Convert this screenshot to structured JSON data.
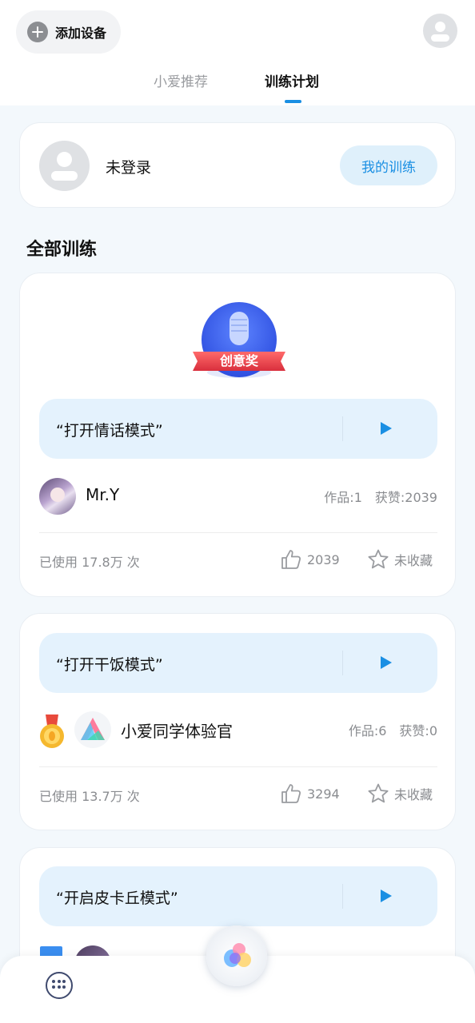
{
  "header": {
    "add_device_label": "添加设备",
    "tabs": [
      {
        "label": "小爱推荐",
        "active": false
      },
      {
        "label": "训练计划",
        "active": true
      }
    ]
  },
  "login": {
    "status_text": "未登录",
    "my_training_label": "我的训练"
  },
  "section_title": "全部训练",
  "badge_text": "创意奖",
  "trainings": [
    {
      "phrase": "“打开情话模式”",
      "author": "Mr.Y",
      "works": "作品:1",
      "likes_received": "获赞:2039",
      "used": "已使用 17.8万 次",
      "like_count": "2039",
      "fav_label": "未收藏"
    },
    {
      "phrase": "“打开干饭模式”",
      "author": "小爱同学体验官",
      "works": "作品:6",
      "likes_received": "获赞:0",
      "used": "已使用 13.7万 次",
      "like_count": "3294",
      "fav_label": "未收藏"
    },
    {
      "phrase": "“开启皮卡丘模式”"
    }
  ],
  "icons": {
    "add": "plus-circle-icon",
    "user": "user-avatar-icon",
    "play": "play-icon",
    "like": "thumbs-up-icon",
    "favorite": "star-icon",
    "menu": "grid-menu-icon",
    "assistant": "xiaoai-assistant-icon"
  },
  "colors": {
    "accent": "#1a8fe3",
    "phrase_bg": "#e4f2fd",
    "badge_blue": "#3d64f0",
    "badge_ribbon": "#e8414a",
    "medal_gold": "#f5b82e"
  }
}
